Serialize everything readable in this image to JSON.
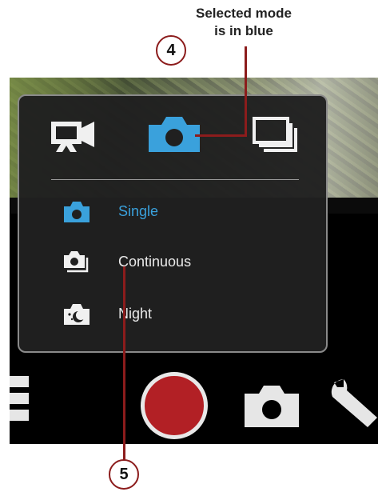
{
  "caption": {
    "line1": "Selected mode",
    "line2": "is in blue"
  },
  "callouts": {
    "c4": "4",
    "c5": "5"
  },
  "mode_tabs": [
    {
      "name": "video",
      "icon": "video-camera-icon",
      "selected": false
    },
    {
      "name": "photo",
      "icon": "camera-icon",
      "selected": true
    },
    {
      "name": "burst",
      "icon": "multi-shot-icon",
      "selected": false
    }
  ],
  "photo_modes": [
    {
      "label": "Single",
      "icon": "camera-icon",
      "selected": true
    },
    {
      "label": "Continuous",
      "icon": "continuous-camera-icon",
      "selected": false
    },
    {
      "label": "Night",
      "icon": "night-camera-icon",
      "selected": false
    }
  ],
  "colors": {
    "selected": "#3aa1dc",
    "unselected": "#eaeaea",
    "shutter": "#b22025",
    "leader": "#8c1c1c"
  },
  "bottom_bar": {
    "icons": [
      "grid-menu-icon",
      "record-shutter-button",
      "camera-mode-icon",
      "wrench-settings-icon"
    ]
  }
}
